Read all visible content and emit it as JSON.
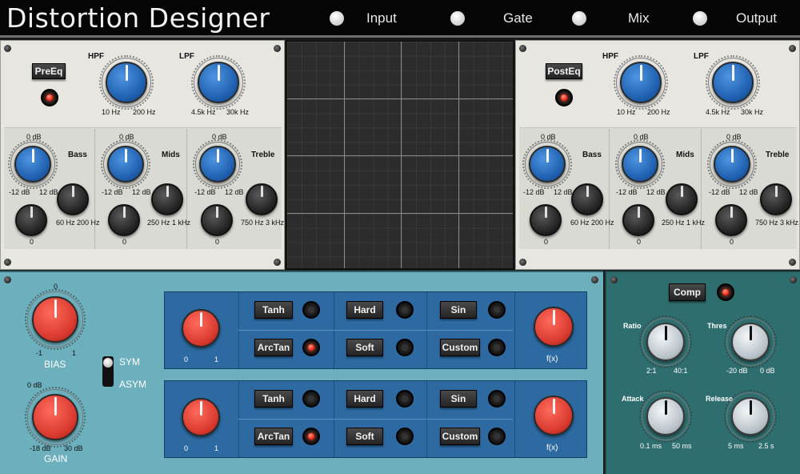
{
  "app": {
    "title": "Distortion Designer"
  },
  "nav": [
    "Input",
    "Gate",
    "Mix",
    "Output"
  ],
  "pre_eq": {
    "button": "PreEq",
    "hpf": {
      "label": "HPF",
      "min": "10 Hz",
      "max": "200 Hz"
    },
    "lpf": {
      "label": "LPF",
      "min": "4.5k Hz",
      "max": "30k Hz"
    },
    "bands": [
      {
        "name": "Bass",
        "top": "0 dB",
        "min": "-12 dB",
        "max": "12 dB",
        "fmin": "60 Hz",
        "fmax": "200 Hz",
        "q": "0"
      },
      {
        "name": "Mids",
        "top": "0 dB",
        "min": "-12 dB",
        "max": "12 dB",
        "fmin": "250 Hz",
        "fmax": "1 kHz",
        "q": "0"
      },
      {
        "name": "Treble",
        "top": "0 dB",
        "min": "-12 dB",
        "max": "12 dB",
        "fmin": "750 Hz",
        "fmax": "3 kHz",
        "q": "0"
      }
    ]
  },
  "post_eq": {
    "button": "PostEq",
    "hpf": {
      "label": "HPF",
      "min": "10 Hz",
      "max": "200 Hz"
    },
    "lpf": {
      "label": "LPF",
      "min": "4.5k Hz",
      "max": "30k Hz"
    },
    "bands": [
      {
        "name": "Bass",
        "top": "0 dB",
        "min": "-12 dB",
        "max": "12 dB",
        "fmin": "60 Hz",
        "fmax": "200 Hz",
        "q": "0"
      },
      {
        "name": "Mids",
        "top": "0 dB",
        "min": "-12 dB",
        "max": "12 dB",
        "fmin": "250 Hz",
        "fmax": "1 kHz",
        "q": "0"
      },
      {
        "name": "Treble",
        "top": "0 dB",
        "min": "-12 dB",
        "max": "12 dB",
        "fmin": "750 Hz",
        "fmax": "3 kHz",
        "q": "0"
      }
    ]
  },
  "bias": {
    "label": "BIAS",
    "top": "0",
    "min": "-1",
    "max": "1"
  },
  "gain": {
    "label": "GAIN",
    "top": "0 dB",
    "min": "-18 dB",
    "max": "30 dB"
  },
  "symmetry": {
    "sym": "SYM",
    "asym": "ASYM"
  },
  "shapers": [
    {
      "mix_min": "0",
      "mix_max": "1",
      "buttons": [
        "Tanh",
        "ArcTan",
        "Hard",
        "Soft",
        "Sin",
        "Custom"
      ],
      "fx": "f(x)"
    },
    {
      "mix_min": "0",
      "mix_max": "1",
      "buttons": [
        "Tanh",
        "ArcTan",
        "Hard",
        "Soft",
        "Sin",
        "Custom"
      ],
      "fx": "f(x)"
    }
  ],
  "comp": {
    "button": "Comp",
    "ratio": {
      "label": "Ratio",
      "min": "2:1",
      "max": "40:1"
    },
    "thres": {
      "label": "Thres",
      "min": "-20 dB",
      "max": "0 dB"
    },
    "attack": {
      "label": "Attack",
      "min": "0.1 ms",
      "max": "50 ms"
    },
    "release": {
      "label": "Release",
      "min": "5 ms",
      "max": "2.5 s"
    }
  }
}
